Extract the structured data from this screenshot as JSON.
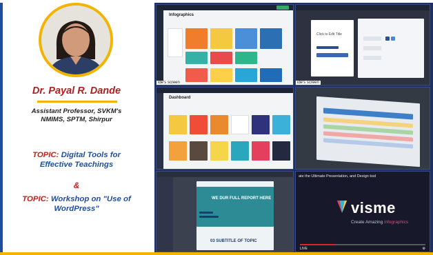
{
  "presenter": {
    "name": "Dr. Payal R. Dande",
    "role_line1": "Assistant Professor, SVKM's",
    "role_line2": "NMIMS, SPTM, Shirpur"
  },
  "topics": {
    "label1": "TOPIC:",
    "text1_line1": "Digital Tools for",
    "text1_line2": "Effective Teachings",
    "amp": "&",
    "label2": "TOPIC:",
    "text2_line1": "Workshop on \"Use of",
    "text2_line2": "WordPress\""
  },
  "screens": {
    "infographics_header": "Infographics",
    "dashboard_header": "Dashboard",
    "screen_caption": "ide's screen",
    "visme_logo": "visme",
    "visme_tagline_a": "Create Amazing",
    "visme_tagline_b": "infographics",
    "video_title": "ate the Ultimate Presentation, and Design tool",
    "report_title": "WE DUR FULL REPORT HERE",
    "subtitle": "03 SUBTITLE OF TOPIC",
    "chart_label": "Click to Edit Title",
    "live": "LIVE"
  },
  "colors": {
    "accent_blue": "#1f4e9a",
    "accent_red": "#c81d1d",
    "accent_gold": "#f2b400",
    "grid_bg": "#1d2f63"
  }
}
